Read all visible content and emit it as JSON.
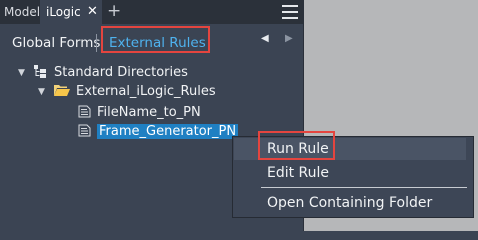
{
  "tabs": {
    "model": "Model",
    "ilogic": "iLogic",
    "close": "✕",
    "add": "+"
  },
  "subtabs": {
    "global": "Global Forms",
    "external": "External Rules"
  },
  "nav": {
    "prev": "◀",
    "next": "▶"
  },
  "tree": {
    "root": "Standard Directories",
    "folder": "External_iLogic_Rules",
    "rules": [
      "FileName_to_PN",
      "Frame_Generator_PN"
    ]
  },
  "context_menu": {
    "items": [
      "Run Rule",
      "Edit Rule",
      "Open Containing Folder"
    ]
  },
  "colors": {
    "accent": "#4fb2ee",
    "selection": "#1f80c3",
    "highlight_box": "#e4453f",
    "panel_bg": "#3b4453"
  }
}
